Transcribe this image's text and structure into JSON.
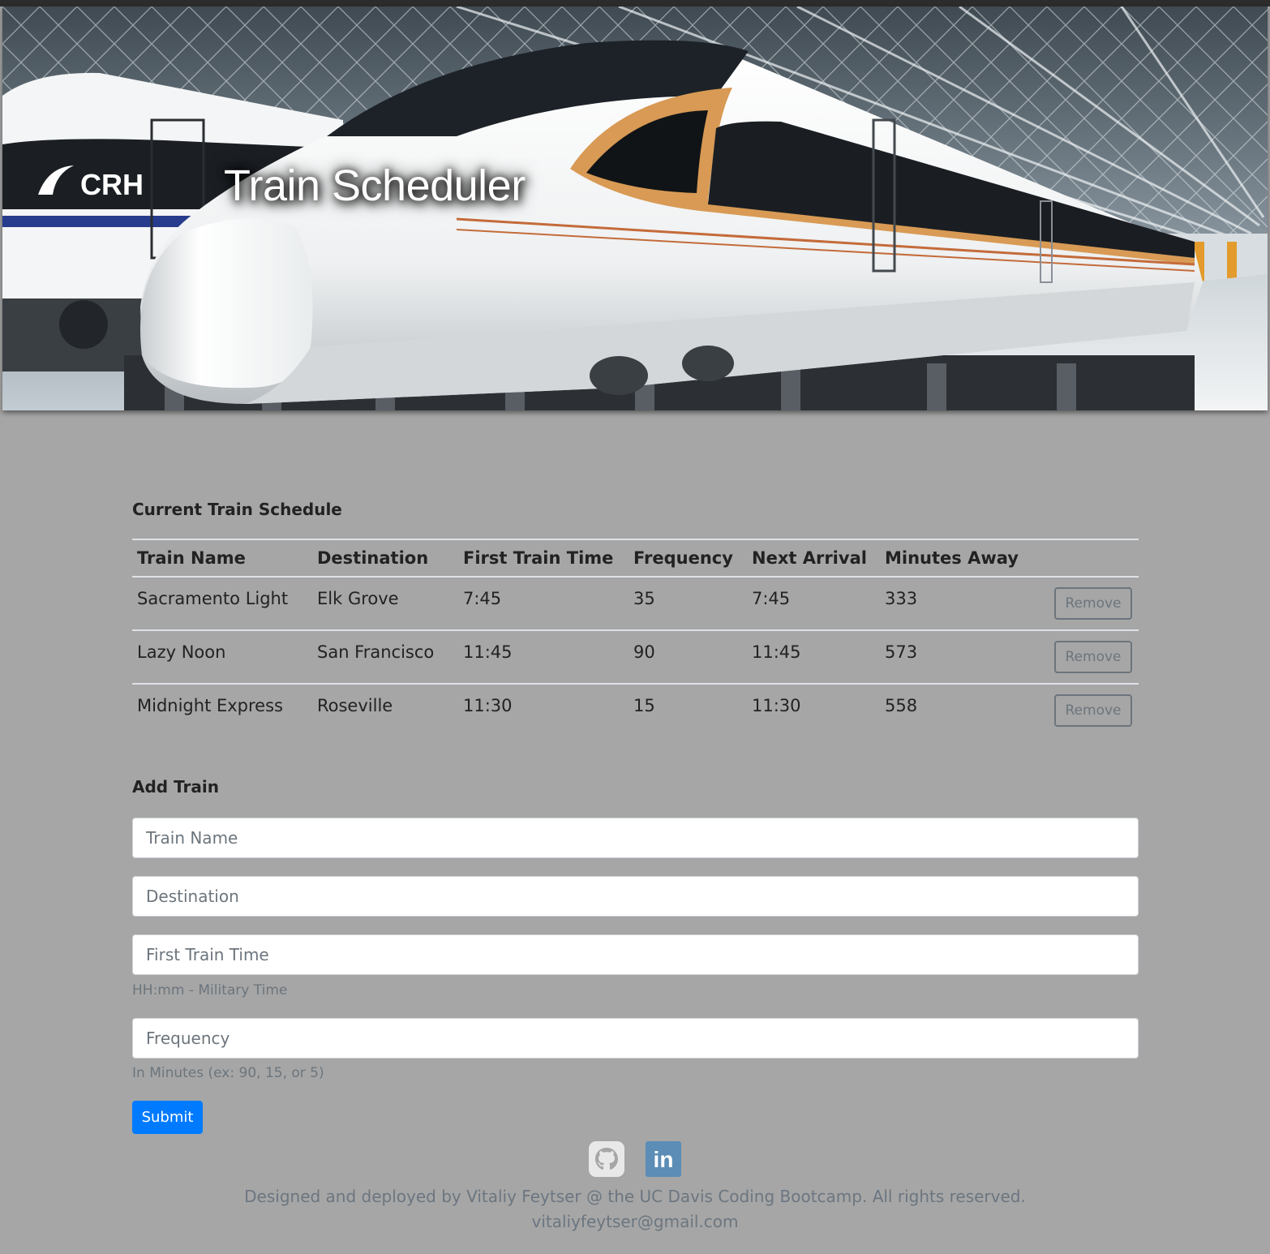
{
  "hero": {
    "title": "Train Scheduler",
    "logo_text": "CRH"
  },
  "schedule": {
    "heading": "Current Train Schedule",
    "columns": [
      "Train Name",
      "Destination",
      "First Train Time",
      "Frequency",
      "Next Arrival",
      "Minutes Away"
    ],
    "rows": [
      {
        "name": "Sacramento Light",
        "destination": "Elk Grove",
        "first": "7:45",
        "frequency": "35",
        "next": "7:45",
        "minutes": "333",
        "action": "Remove"
      },
      {
        "name": "Lazy Noon",
        "destination": "San Francisco",
        "first": "11:45",
        "frequency": "90",
        "next": "11:45",
        "minutes": "573",
        "action": "Remove"
      },
      {
        "name": "Midnight Express",
        "destination": "Roseville",
        "first": "11:30",
        "frequency": "15",
        "next": "11:30",
        "minutes": "558",
        "action": "Remove"
      }
    ]
  },
  "form": {
    "heading": "Add Train",
    "train_name_placeholder": "Train Name",
    "destination_placeholder": "Destination",
    "first_time_placeholder": "First Train Time",
    "first_time_help": "HH:mm - Military Time",
    "frequency_placeholder": "Frequency",
    "frequency_help": "In Minutes (ex: 90, 15, or 5)",
    "submit_label": "Submit"
  },
  "footer": {
    "credit": "Designed and deployed by Vitaliy Feytser @ the UC Davis Coding Bootcamp. All rights reserved.",
    "email": "vitaliyfeytser@gmail.com",
    "icons": [
      "github-icon",
      "linkedin-icon"
    ],
    "linkedin_text": "in"
  },
  "colors": {
    "page_bg": "#a6a6a6",
    "primary": "#007bff",
    "secondary": "#6c757d",
    "linkedin": "#5b8db6",
    "github": "#e8e8e8"
  }
}
